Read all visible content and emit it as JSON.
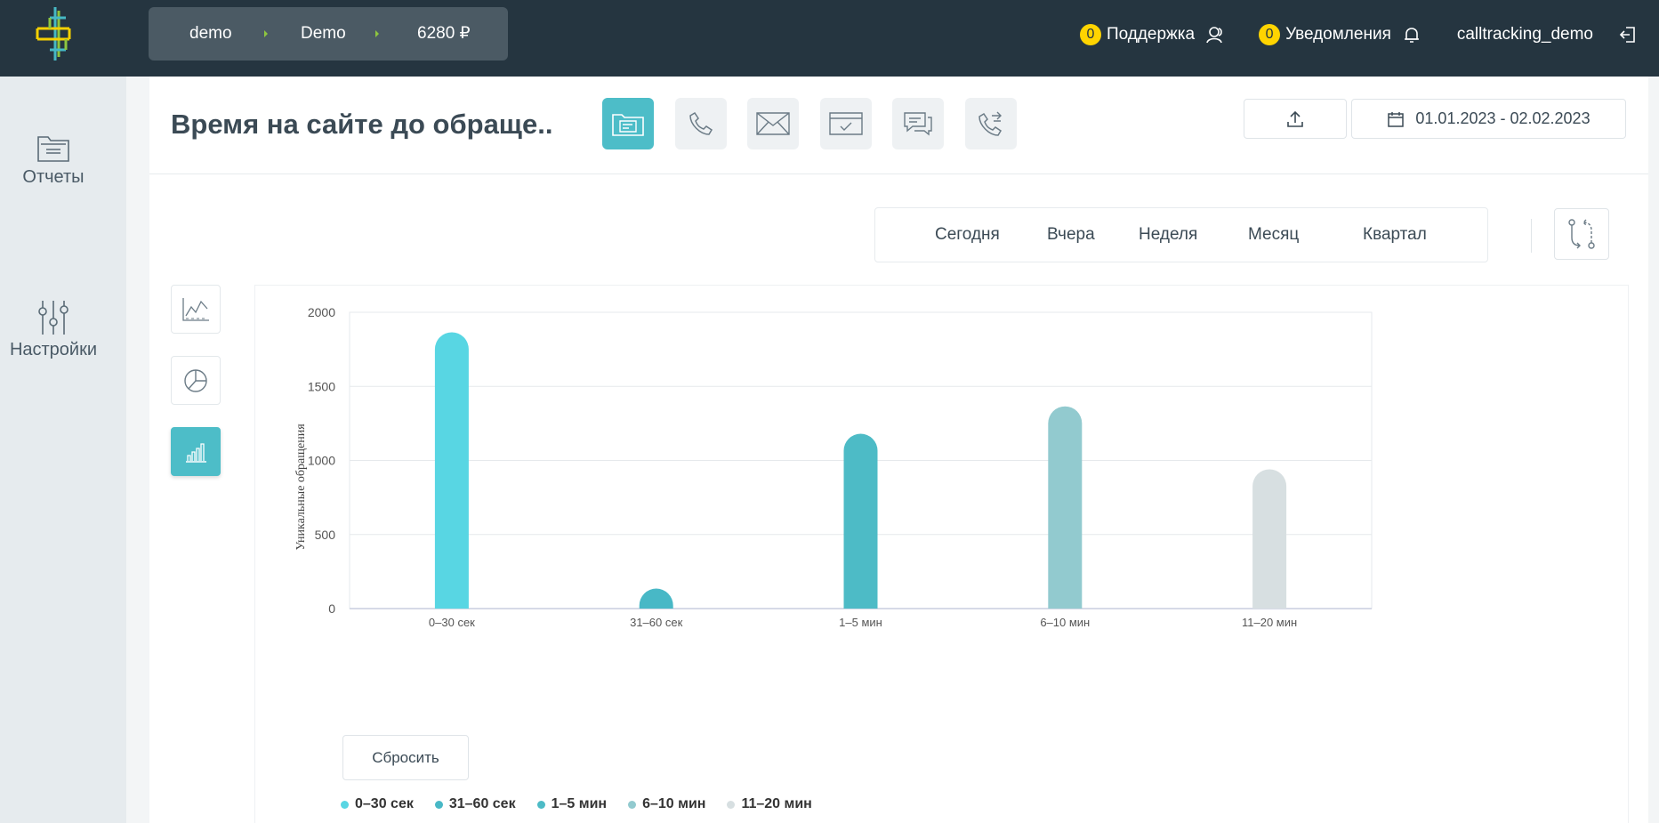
{
  "topbar": {
    "crumbs": [
      "demo",
      "Demo",
      "6280 ₽"
    ],
    "support": {
      "count": "0",
      "label": "Поддержка"
    },
    "notifications": {
      "count": "0",
      "label": "Уведомления"
    },
    "user": "calltracking_demo"
  },
  "sidebar": {
    "items": [
      {
        "label": "Отчеты",
        "icon": "folder-icon"
      },
      {
        "label": "Настройки",
        "icon": "sliders-icon"
      }
    ]
  },
  "header": {
    "title": "Время на сайте до обраще...",
    "types": [
      "all-requests-icon",
      "phone-icon",
      "mail-icon",
      "form-icon",
      "chat-icon",
      "callback-icon"
    ],
    "date_range": "01.01.2023 - 02.02.2023"
  },
  "periods": [
    "Сегодня",
    "Вчера",
    "Неделя",
    "Месяц",
    "Квартал"
  ],
  "actions": {
    "reset": "Сбросить"
  },
  "colors": {
    "accent": "#4dbdc8",
    "topbar": "#253540",
    "badge": "#ffd400"
  },
  "chart_data": {
    "type": "bar",
    "ylabel": "Уникальные обращения",
    "ylim": [
      0,
      2000
    ],
    "yticks": [
      "2000",
      "1500",
      "1000",
      "500",
      "0"
    ],
    "categories": [
      "0–30 сек",
      "31–60 сек",
      "1–5 мин",
      "6–10 мин",
      "11–20 мин"
    ],
    "values": [
      1865,
      135,
      1180,
      1365,
      940
    ],
    "colors": [
      "#58d6e3",
      "#48b8c6",
      "#4dbbc6",
      "#92cacf",
      "#d7dfe1"
    ],
    "grid": true,
    "legend": "bottom-left"
  }
}
